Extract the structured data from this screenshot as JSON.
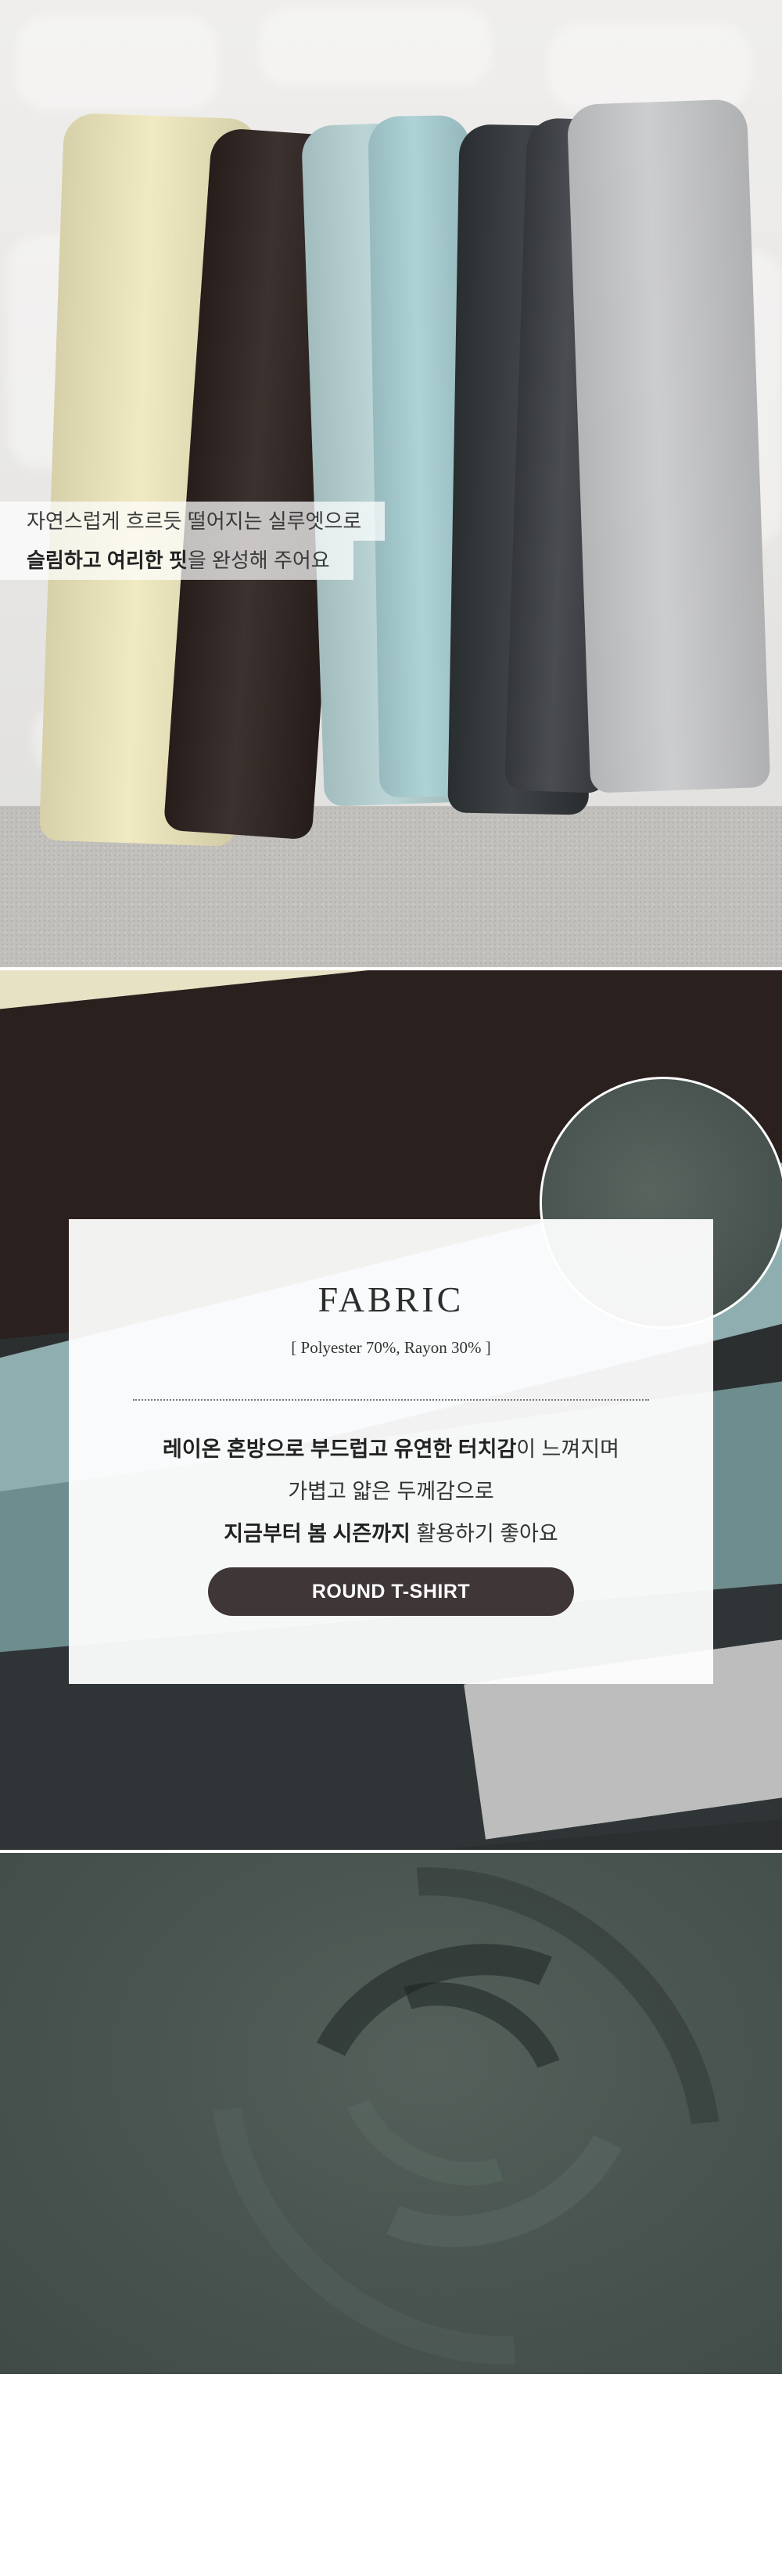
{
  "section_photo": {
    "caption_line1": "자연스럽게 흐르듯 떨어지는 실루엣으로",
    "caption_line2_bold": "슬림하고 여리한 핏",
    "caption_line2_rest": "을 완성해 주어요",
    "shirt_colors": [
      "#f1ebc1",
      "#2a1f1c",
      "#b9d3d4",
      "#a9cfd3",
      "#2f3336",
      "#3a3c40",
      "#c6c7c9"
    ]
  },
  "fabric_card": {
    "title": "FABRIC",
    "composition": "[ Polyester 70%, Rayon 30% ]",
    "desc1_bold": "레이온 혼방으로 부드럽고 유연한 터치감",
    "desc1_rest": "이 느껴지며",
    "desc2": "가볍고 얇은 두께감으로",
    "desc3_bold": "지금부터 봄 시즌까지",
    "desc3_rest": " 활용하기 좋아요",
    "button_label": "ROUND T-SHIRT",
    "button_color": "#3f3637"
  }
}
